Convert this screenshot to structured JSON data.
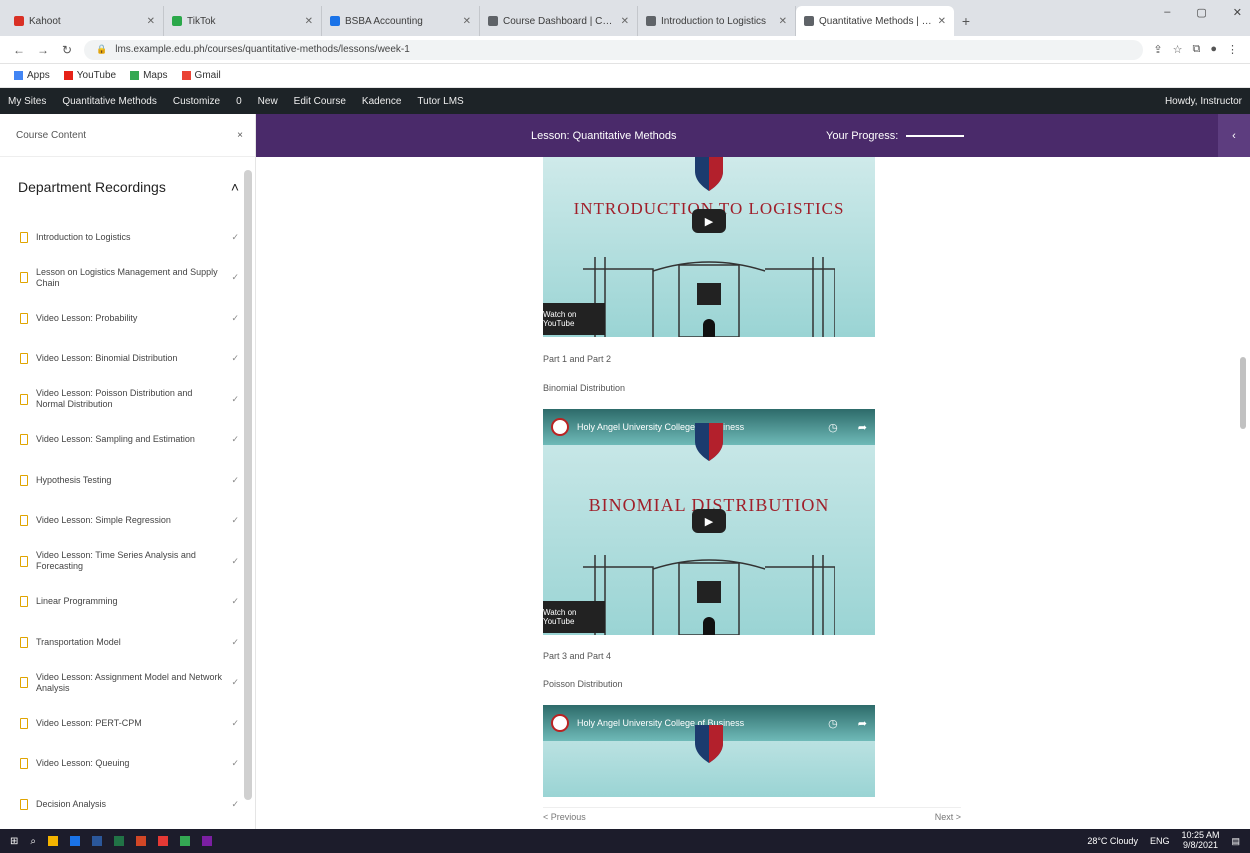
{
  "browser": {
    "tabs": [
      {
        "label": "Kahoot",
        "color": "#d93025"
      },
      {
        "label": "TikTok",
        "color": "#2ba84a"
      },
      {
        "label": "BSBA Accounting",
        "color": "#1a73e8"
      },
      {
        "label": "Course Dashboard | Canvas",
        "color": "#5f6368"
      },
      {
        "label": "Introduction to Logistics",
        "color": "#5f6368"
      },
      {
        "label": "Quantitative Methods | Courses",
        "color": "#5f6368",
        "active": true
      }
    ],
    "new_tab": "+",
    "url": "lms.example.edu.ph/courses/quantitative-methods/lessons/week-1",
    "window": {
      "min": "–",
      "max": "▢",
      "close": "✕"
    }
  },
  "bookmarks": [
    {
      "label": "Apps",
      "color": "#4285f4"
    },
    {
      "label": "YouTube",
      "color": "#e62117"
    },
    {
      "label": "Maps",
      "color": "#34a853"
    },
    {
      "label": "Gmail",
      "color": "#ea4335"
    }
  ],
  "wp_admin": {
    "items": [
      "My Sites",
      "Quantitative Methods",
      "Customize",
      "0",
      "New",
      "Edit Course",
      "Kadence",
      "Tutor LMS"
    ],
    "right": "Howdy, Instructor"
  },
  "sidebar": {
    "header": "Course Content",
    "section_title": "Department Recordings",
    "lessons": [
      {
        "label": "Introduction to Logistics",
        "status": "✓"
      },
      {
        "label": "Lesson on Logistics Management and Supply Chain",
        "status": "✓"
      },
      {
        "label": "Video Lesson: Probability",
        "status": "✓"
      },
      {
        "label": "Video Lesson: Binomial Distribution",
        "status": "✓"
      },
      {
        "label": "Video Lesson: Poisson Distribution and Normal Distribution",
        "status": "✓"
      },
      {
        "label": "Video Lesson: Sampling and Estimation",
        "status": "✓"
      },
      {
        "label": "Hypothesis Testing",
        "status": "✓"
      },
      {
        "label": "Video Lesson: Simple Regression",
        "status": "✓"
      },
      {
        "label": "Video Lesson: Time Series Analysis and Forecasting",
        "status": "✓"
      },
      {
        "label": "Linear Programming",
        "status": "✓"
      },
      {
        "label": "Transportation Model",
        "status": "✓"
      },
      {
        "label": "Video Lesson: Assignment Model and Network Analysis",
        "status": "✓"
      },
      {
        "label": "Video Lesson: PERT-CPM",
        "status": "✓"
      },
      {
        "label": "Video Lesson: Queuing",
        "status": "✓"
      },
      {
        "label": "Decision Analysis",
        "status": "✓"
      }
    ]
  },
  "topbar": {
    "title": "Lesson: Quantitative Methods",
    "progress_label": "Your Progress:",
    "progress_value": 1
  },
  "videos": [
    {
      "title": "INTRODUCTION TO LOGISTICS",
      "channel": "",
      "watch_label": "Watch on YouTube"
    },
    {
      "title": "BINOMIAL DISTRIBUTION",
      "channel": "Holy Angel University College of Business",
      "watch_label": "Watch on YouTube",
      "controls": [
        "Watch later",
        "Share"
      ]
    },
    {
      "title": "",
      "channel": "Holy Angel University College of Business",
      "controls": [
        "Watch later",
        "Share"
      ]
    }
  ],
  "captions": {
    "c1": "Part 1 and Part 2",
    "c2": "Binomial Distribution",
    "c3": "Part 3 and Part 4",
    "c4": "Poisson Distribution"
  },
  "footer_nav": {
    "prev": "< Previous",
    "next": "Next >"
  },
  "taskbar": {
    "start": "⊞",
    "search": "⌕",
    "clock_time": "10:25 AM",
    "clock_date": "9/8/2021",
    "weather": "28°C Cloudy",
    "lang": "ENG"
  }
}
